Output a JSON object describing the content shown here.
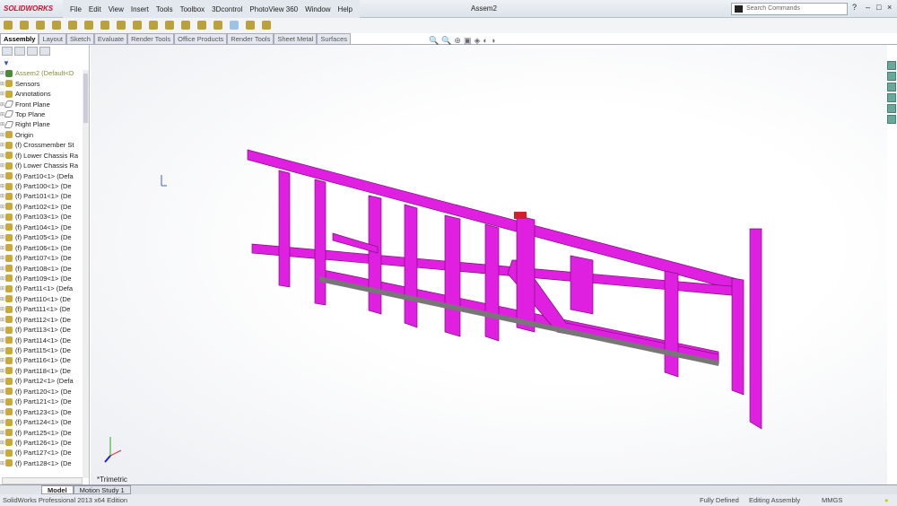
{
  "app": {
    "logo": "SOLIDWORKS",
    "document_title": "Assem2",
    "search_placeholder": "Search Commands"
  },
  "menu": [
    "File",
    "Edit",
    "View",
    "Insert",
    "Tools",
    "Toolbox",
    "3Dcontrol",
    "PhotoView 360",
    "Window",
    "Help"
  ],
  "tabs": [
    "Assembly",
    "Layout",
    "Sketch",
    "Evaluate",
    "Render Tools",
    "Office Products",
    "Render Tools",
    "Sheet Metal",
    "Surfaces"
  ],
  "tree": {
    "root": "Assem2  (Default<D",
    "items": [
      {
        "label": "Sensors",
        "icon": "sensor-icon"
      },
      {
        "label": "Annotations",
        "icon": "annotation-icon"
      },
      {
        "label": "Front Plane",
        "icon": "plane-icon"
      },
      {
        "label": "Top Plane",
        "icon": "plane-icon"
      },
      {
        "label": "Right Plane",
        "icon": "plane-icon"
      },
      {
        "label": "Origin",
        "icon": "origin-icon"
      },
      {
        "label": "(f) Crossmember St",
        "icon": "part-icon"
      },
      {
        "label": "(f) Lower Chassis Ra",
        "icon": "part-icon"
      },
      {
        "label": "(f) Lower Chassis Ra",
        "icon": "part-icon"
      },
      {
        "label": "(f) Part10<1> (Defa",
        "icon": "part-icon"
      },
      {
        "label": "(f) Part100<1> (De",
        "icon": "part-icon"
      },
      {
        "label": "(f) Part101<1> (De",
        "icon": "part-icon"
      },
      {
        "label": "(f) Part102<1> (De",
        "icon": "part-icon"
      },
      {
        "label": "(f) Part103<1> (De",
        "icon": "part-icon"
      },
      {
        "label": "(f) Part104<1> (De",
        "icon": "part-icon"
      },
      {
        "label": "(f) Part105<1> (De",
        "icon": "part-icon"
      },
      {
        "label": "(f) Part106<1> (De",
        "icon": "part-icon"
      },
      {
        "label": "(f) Part107<1> (De",
        "icon": "part-icon"
      },
      {
        "label": "(f) Part108<1> (De",
        "icon": "part-icon"
      },
      {
        "label": "(f) Part109<1> (De",
        "icon": "part-icon"
      },
      {
        "label": "(f) Part11<1> (Defa",
        "icon": "part-icon"
      },
      {
        "label": "(f) Part110<1> (De",
        "icon": "part-icon"
      },
      {
        "label": "(f) Part111<1> (De",
        "icon": "part-icon"
      },
      {
        "label": "(f) Part112<1> (De",
        "icon": "part-icon"
      },
      {
        "label": "(f) Part113<1> (De",
        "icon": "part-icon"
      },
      {
        "label": "(f) Part114<1> (De",
        "icon": "part-icon"
      },
      {
        "label": "(f) Part115<1> (De",
        "icon": "part-icon"
      },
      {
        "label": "(f) Part116<1> (De",
        "icon": "part-icon"
      },
      {
        "label": "(f) Part118<1> (De",
        "icon": "part-icon"
      },
      {
        "label": "(f) Part12<1> (Defa",
        "icon": "part-icon"
      },
      {
        "label": "(f) Part120<1> (De",
        "icon": "part-icon"
      },
      {
        "label": "(f) Part121<1> (De",
        "icon": "part-icon"
      },
      {
        "label": "(f) Part123<1> (De",
        "icon": "part-icon"
      },
      {
        "label": "(f) Part124<1> (De",
        "icon": "part-icon"
      },
      {
        "label": "(f) Part125<1> (De",
        "icon": "part-icon"
      },
      {
        "label": "(f) Part126<1> (De",
        "icon": "part-icon"
      },
      {
        "label": "(f) Part127<1> (De",
        "icon": "part-icon"
      },
      {
        "label": "(f) Part128<1> (De",
        "icon": "part-icon"
      }
    ]
  },
  "viewport": {
    "view_label": "*Trimetric",
    "model_color": "#e020e0"
  },
  "bottom_tabs": [
    "Model",
    "Motion Study 1"
  ],
  "status": {
    "edition": "SolidWorks Professional 2013 x64 Edition",
    "state": "Fully Defined",
    "mode": "Editing Assembly",
    "units": "MMGS"
  }
}
